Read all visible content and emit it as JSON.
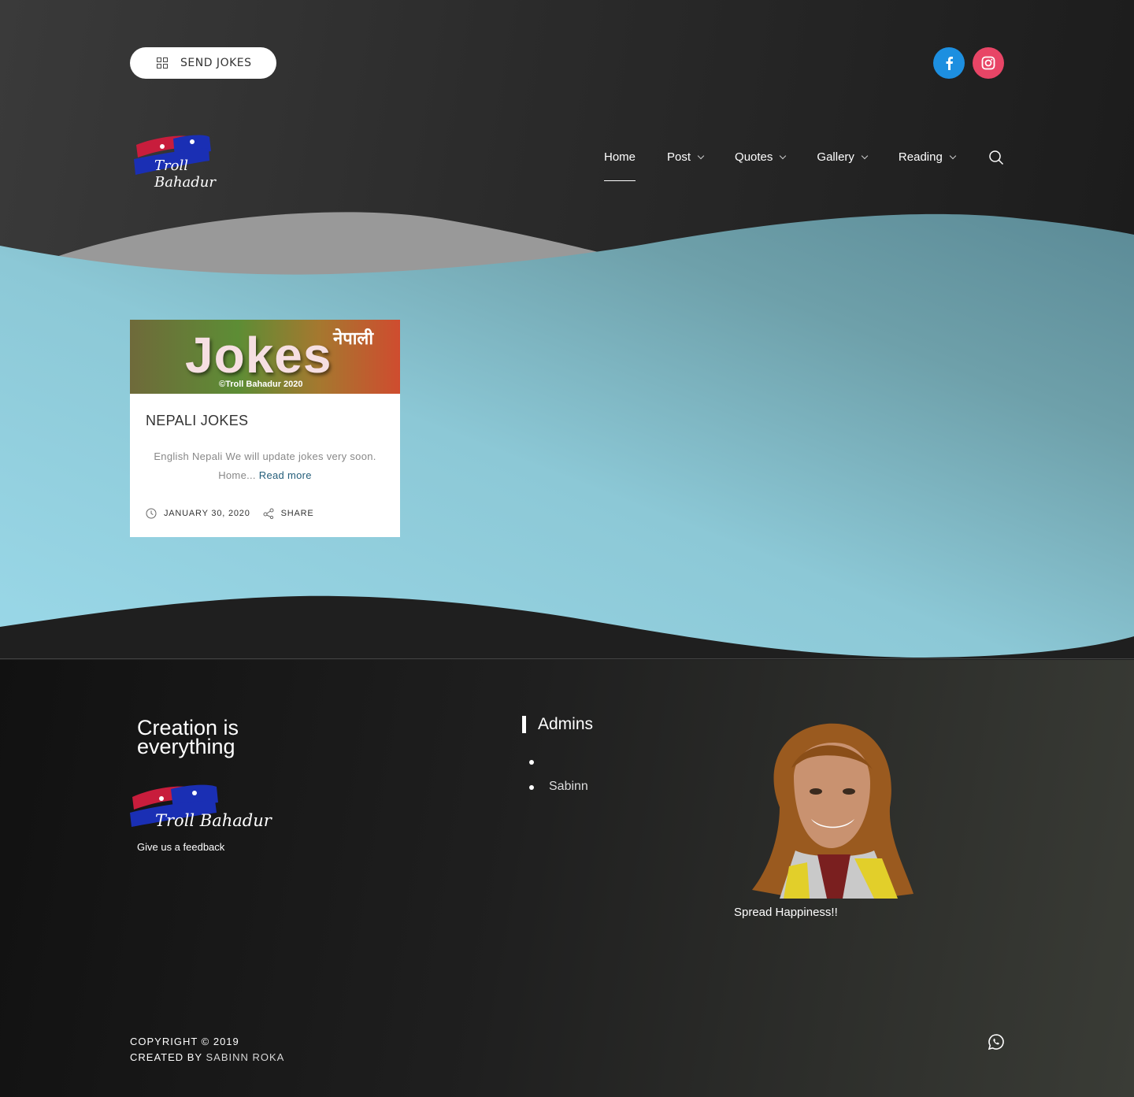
{
  "header": {
    "send_button_label": "SEND JOKES",
    "social": [
      {
        "name": "facebook",
        "icon": "facebook-icon",
        "color": "#1d8fe0"
      },
      {
        "name": "instagram",
        "icon": "instagram-icon",
        "color": "#e84566"
      }
    ],
    "logo_text": "Troll Bahadur",
    "nav": [
      {
        "label": "Home",
        "active": true
      },
      {
        "label": "Post",
        "has_dropdown": true
      },
      {
        "label": "Quotes",
        "has_dropdown": true
      },
      {
        "label": "Gallery",
        "has_dropdown": true
      },
      {
        "label": "Reading",
        "has_dropdown": true
      }
    ]
  },
  "post": {
    "image_word": "Jokes",
    "image_word_nepali": "नेपाली",
    "image_copyright": "©Troll Bahadur 2020",
    "title": "NEPALI JOKES",
    "excerpt": "English Nepali We will update jokes very soon. Home...",
    "read_more": "Read more",
    "date": "JANUARY 30, 2020",
    "share": "SHARE"
  },
  "footer": {
    "slogan": "Creation is everything",
    "logo_text": "Troll Bahadur",
    "feedback": "Give us a feedback",
    "admins_title": "Admins",
    "admins": [
      "",
      "Sabinn"
    ],
    "caption": "Spread Happiness!!",
    "copyright": "COPYRIGHT © 2019",
    "created_by": "CREATED BY",
    "author": "SABINN ROKA",
    "whatsapp_icon": "whatsapp-icon"
  },
  "colors": {
    "accent_link": "#245e7a",
    "facebook": "#1d8fe0",
    "instagram": "#e84566",
    "band_light": "#96d3e0",
    "band_dark": "#5b8a96"
  }
}
